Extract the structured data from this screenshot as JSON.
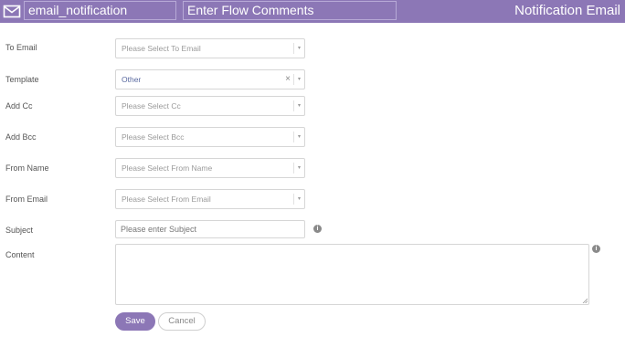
{
  "header": {
    "flow_name": "email_notification",
    "flow_comments_placeholder": "Enter Flow Comments",
    "title": "Notification Email",
    "background_color": "#8c77b6"
  },
  "form": {
    "to_email": {
      "label": "To Email",
      "placeholder": "Please Select To Email"
    },
    "template": {
      "label": "Template",
      "value": "Other"
    },
    "add_cc": {
      "label": "Add Cc",
      "placeholder": "Please Select Cc"
    },
    "add_bcc": {
      "label": "Add Bcc",
      "placeholder": "Please Select Bcc"
    },
    "from_name": {
      "label": "From Name",
      "placeholder": "Please Select From Name"
    },
    "from_email": {
      "label": "From Email",
      "placeholder": "Please Select From Email"
    },
    "subject": {
      "label": "Subject",
      "placeholder": "Please enter Subject"
    },
    "content": {
      "label": "Content",
      "value": ""
    }
  },
  "icons": {
    "caret": "▾",
    "clear": "×",
    "info": "i"
  },
  "buttons": {
    "save": "Save",
    "cancel": "Cancel"
  }
}
